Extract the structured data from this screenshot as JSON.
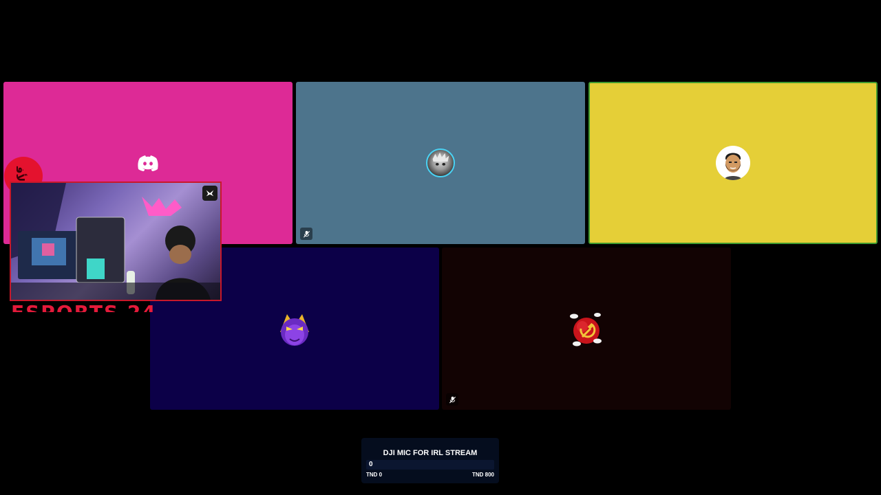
{
  "participants": [
    {
      "id": "user1",
      "avatar": "discord-logo-icon",
      "bg_color": "#dd2a96",
      "muted": false,
      "speaking": false
    },
    {
      "id": "user2",
      "avatar": "anime-character-avatar",
      "bg_color": "#4d748c",
      "muted": true,
      "speaking": false
    },
    {
      "id": "user3",
      "avatar": "bearded-man-avatar",
      "bg_color": "#e5cf37",
      "muted": false,
      "speaking": true
    },
    {
      "id": "user4",
      "avatar": "purple-mascot-avatar",
      "bg_color": "#0c0048",
      "muted": false,
      "speaking": false
    },
    {
      "id": "user5",
      "avatar": "hammer-sickle-planet-avatar",
      "bg_color": "#120303",
      "muted": true,
      "speaking": false
    }
  ],
  "webcam": {
    "badge_icon": "overlay-logo-icon",
    "border_color": "#c8182a"
  },
  "overlay": {
    "circle_text": "ﺍﻷﻓ",
    "banner_text": "ESPORTS 24"
  },
  "goal": {
    "title": "DJI MIC FOR IRL STREAM",
    "current": "0",
    "min_label": "TND 0",
    "max_label": "TND 800",
    "progress_fraction": 0
  },
  "colors": {
    "accent_blue": "#2f7de1",
    "speaking_border": "#3f9a2f"
  }
}
